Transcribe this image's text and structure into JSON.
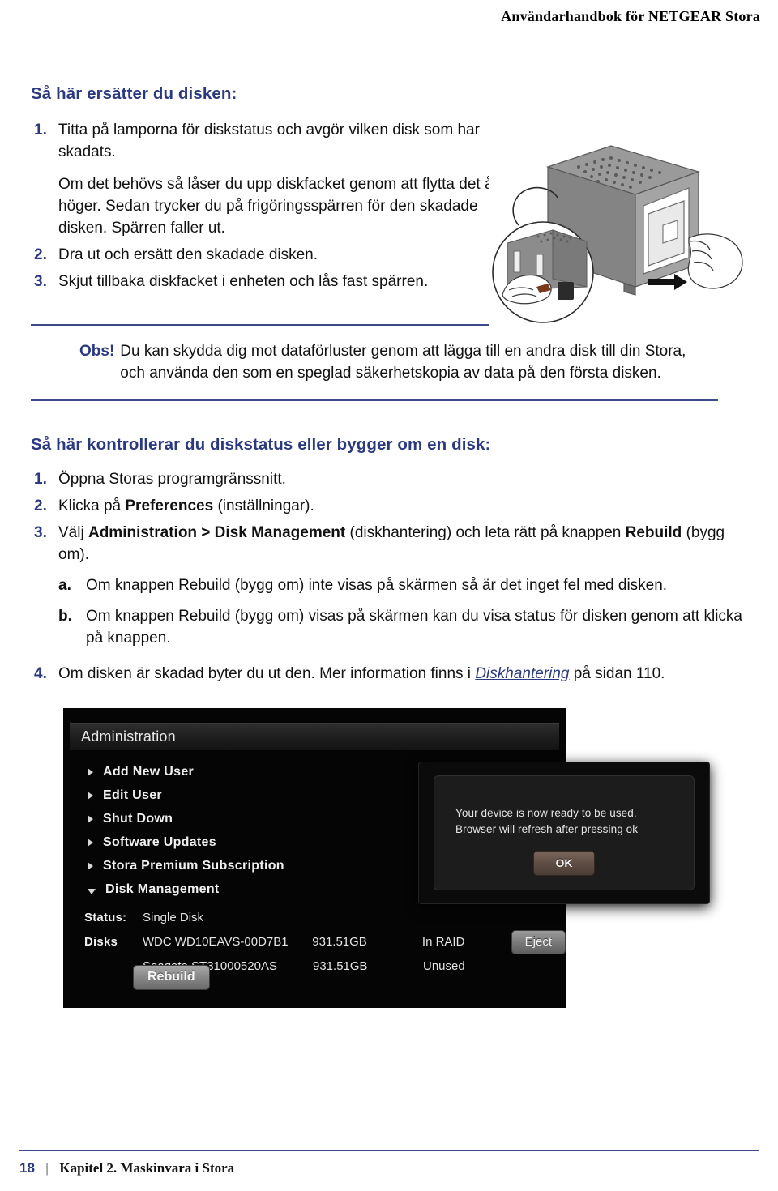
{
  "header": {
    "running_head": "Användarhandbok för NETGEAR Stora"
  },
  "section_replace": {
    "heading": "Så här ersätter du disken:",
    "steps": [
      {
        "num": "1.",
        "paragraphs": [
          "Titta på lamporna för diskstatus och avgör vilken disk som har skadats.",
          "Om det behövs så låser du upp diskfacket genom att flytta det åt höger. Sedan trycker du på frigöringsspärren för den skadade disken. Spärren faller ut."
        ]
      },
      {
        "num": "2.",
        "paragraphs": [
          "Dra ut och ersätt den skadade disken."
        ]
      },
      {
        "num": "3.",
        "paragraphs": [
          "Skjut tillbaka diskfacket i enheten och lås fast spärren."
        ]
      }
    ]
  },
  "figure": {
    "caption": "",
    "alt_name": "stora-disk-removal-illustration"
  },
  "note": {
    "label": "Obs!",
    "text": "Du kan skydda dig mot dataförluster genom att lägga till en andra disk till din Stora, och använda den som en speglad säkerhetskopia av data på den första disken."
  },
  "section_check": {
    "heading": "Så här kontrollerar du diskstatus eller bygger om en disk:",
    "step1": {
      "num": "1.",
      "text": "Öppna Storas programgränssnitt."
    },
    "step2": {
      "num": "2.",
      "text_before": "Klicka på ",
      "bold": "Preferences",
      "text_after": " (inställningar)."
    },
    "step3": {
      "num": "3.",
      "text_before": "Välj ",
      "bold1": "Administration > Disk Management",
      "text_middle": " (diskhantering) och leta rätt på knappen ",
      "bold2": "Rebuild",
      "text_after": " (bygg om).",
      "substeps": [
        {
          "num": "a.",
          "text": "Om knappen Rebuild (bygg om) inte visas på skärmen så är det inget fel med disken."
        },
        {
          "num": "b.",
          "text": "Om knappen Rebuild (bygg om) visas på skärmen kan du visa status för disken genom att klicka på knappen."
        }
      ]
    },
    "step4": {
      "num": "4.",
      "text_before": "Om disken är skadad byter du ut den. Mer information finns i ",
      "link": "Diskhantering",
      "text_after": " på sidan 110."
    }
  },
  "screenshot": {
    "admin": {
      "title": "Administration",
      "menu_items": [
        {
          "label": "Add New User",
          "icon": "chevron-right-icon",
          "expanded": false
        },
        {
          "label": "Edit User",
          "icon": "chevron-right-icon",
          "expanded": false
        },
        {
          "label": "Shut Down",
          "icon": "chevron-right-icon",
          "expanded": false
        },
        {
          "label": "Software Updates",
          "icon": "chevron-right-icon",
          "expanded": false
        },
        {
          "label": "Stora Premium Subscription",
          "icon": "chevron-right-icon",
          "expanded": false
        },
        {
          "label": "Disk Management",
          "icon": "chevron-down-icon",
          "expanded": true
        }
      ],
      "status_label": "Status:",
      "status_value": "Single Disk",
      "disks_label": "Disks",
      "disks": [
        {
          "name": "WDC WD10EAVS-00D7B1",
          "size": "931.51GB",
          "state": "In RAID",
          "action": "Eject"
        },
        {
          "name": "Seagate ST31000520AS",
          "size": "931.51GB",
          "state": "Unused",
          "action": ""
        }
      ],
      "rebuild_button": "Rebuild"
    },
    "dialog": {
      "message": "Your device is now ready to be used.  Browser will refresh after pressing ok",
      "ok_button": "OK"
    }
  },
  "footer": {
    "page_number": "18",
    "separator": "|",
    "chapter": "Kapitel 2.  Maskinvara i Stora"
  },
  "colors": {
    "accent_navy": "#2b3a80",
    "rule_navy": "#3d4a8c",
    "body_text": "#111111",
    "screenshot_bg": "#050505"
  }
}
